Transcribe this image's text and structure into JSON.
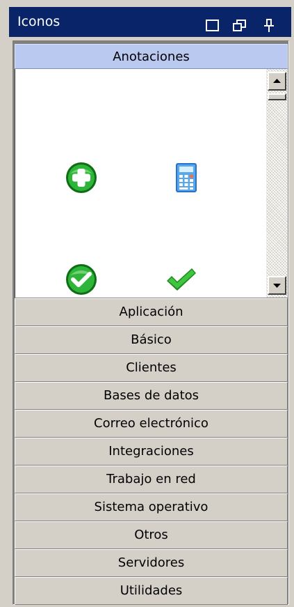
{
  "window": {
    "title": "Iconos"
  },
  "toolbox": {
    "active_group": "Anotaciones",
    "icons": [
      {
        "name": "add-icon",
        "color": "#1e9e2a"
      },
      {
        "name": "calculator-icon",
        "color": "#3a86d8"
      },
      {
        "name": "check-circle-icon",
        "color": "#1e9e2a"
      },
      {
        "name": "checkmark-icon",
        "color": "#2aa82a"
      }
    ],
    "groups": [
      {
        "label": "Aplicación"
      },
      {
        "label": "Básico"
      },
      {
        "label": "Clientes"
      },
      {
        "label": "Bases de datos"
      },
      {
        "label": "Correo electrónico"
      },
      {
        "label": "Integraciones"
      },
      {
        "label": "Trabajo en red"
      },
      {
        "label": "Sistema operativo"
      },
      {
        "label": "Otros"
      },
      {
        "label": "Servidores"
      },
      {
        "label": "Utilidades"
      }
    ]
  },
  "colors": {
    "titlebar": "#0a246a",
    "active_header": "#b9c9f0",
    "face": "#d4d0c8"
  }
}
